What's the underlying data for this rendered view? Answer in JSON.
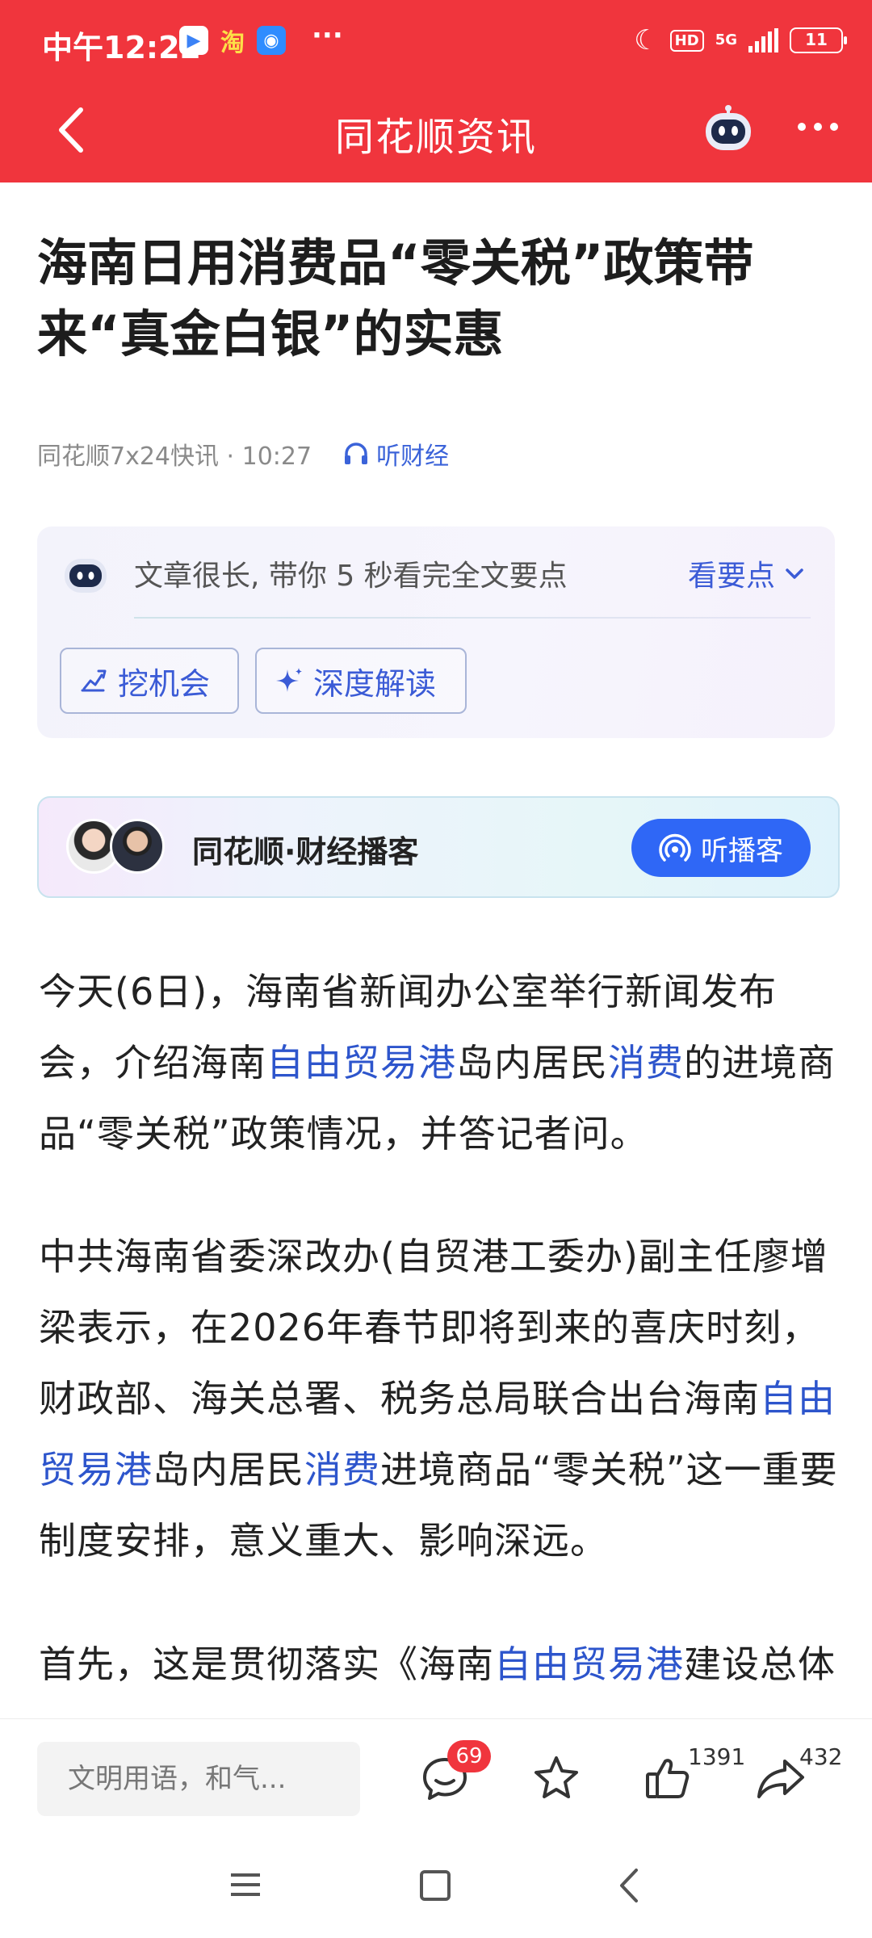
{
  "status_bar": {
    "time": "中午12:22",
    "app_icon_1": "▶",
    "app_icon_2": "淘",
    "app_icon_3": "◉",
    "more": "···",
    "hd": "HD",
    "network": "5G",
    "battery": "11"
  },
  "nav": {
    "title": "同花顺资讯"
  },
  "article": {
    "headline": "海南日用消费品“零关税”政策带来“真金白银”的实惠",
    "source_time": "同花顺7x24快讯 · 10:27",
    "listen_label": "听财经"
  },
  "ai_summary": {
    "text": "文章很长, 带你 5 秒看完全文要点",
    "toggle_label": "看要点",
    "button_opportunity": "挖机会",
    "button_deep_read": "深度解读"
  },
  "podcast": {
    "title": "同花顺·财经播客",
    "button_label": "听播客"
  },
  "body": {
    "p1_a": "今天(6日)，海南省新闻办公室举行新闻发布会，介绍海南",
    "p1_kw1": "自由贸易港",
    "p1_b": "岛内居民",
    "p1_kw2": "消费",
    "p1_c": "的进境商品“零关税”政策情况，并答记者问。",
    "p2_a": "中共海南省委深改办(自贸港工委办)副主任廖增梁表示，在2026年春节即将到来的喜庆时刻，财政部、海关总署、税务总局联合出台海南",
    "p2_kw1": "自由贸易港",
    "p2_b": "岛内居民",
    "p2_kw2": "消费",
    "p2_c": "进境商品“零关税”这一重要制度安排，意义重大、影响深远。",
    "p3_a": "首先，这是贯彻落实《海南",
    "p3_kw1": "自由贸易港",
    "p3_b": "建设总体方案》的具体举措"
  },
  "bottom_bar": {
    "comment_placeholder": "文明用语，和气...",
    "comment_count": "69",
    "like_count": "1391",
    "share_count": "432"
  },
  "colors": {
    "brand_red": "#f0353d",
    "link_blue": "#2d55cc",
    "podcast_button": "#2f67f6"
  }
}
